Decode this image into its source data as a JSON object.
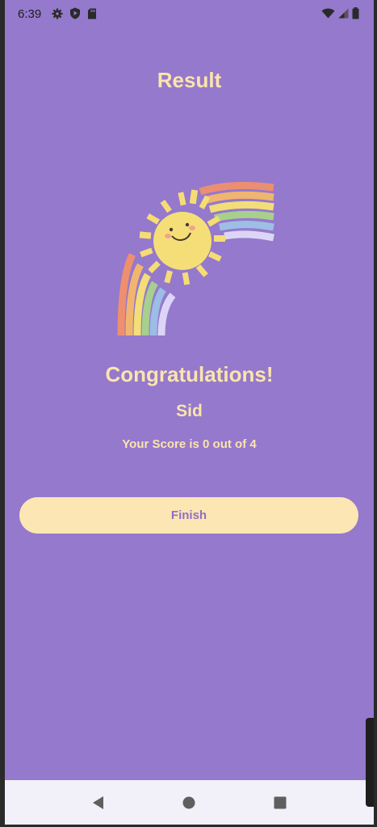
{
  "status_bar": {
    "time": "6:39",
    "left_icons": [
      "gear-icon",
      "play-protect-icon",
      "sd-card-icon"
    ],
    "right_icons": [
      "wifi-icon",
      "signal-icon",
      "battery-icon"
    ]
  },
  "header": {
    "title": "Result"
  },
  "result": {
    "congrats_text": "Congratulations!",
    "player_name": "Sid",
    "score_text": "Your Score is 0 out of 4"
  },
  "actions": {
    "finish_label": "Finish"
  },
  "nav_bar": {
    "buttons": [
      "back-icon",
      "home-icon",
      "recents-icon"
    ]
  },
  "colors": {
    "background": "#9479cc",
    "text_accent": "#fbe4ad",
    "button_bg": "#fbe6b4",
    "button_text": "#8f6fc6"
  }
}
